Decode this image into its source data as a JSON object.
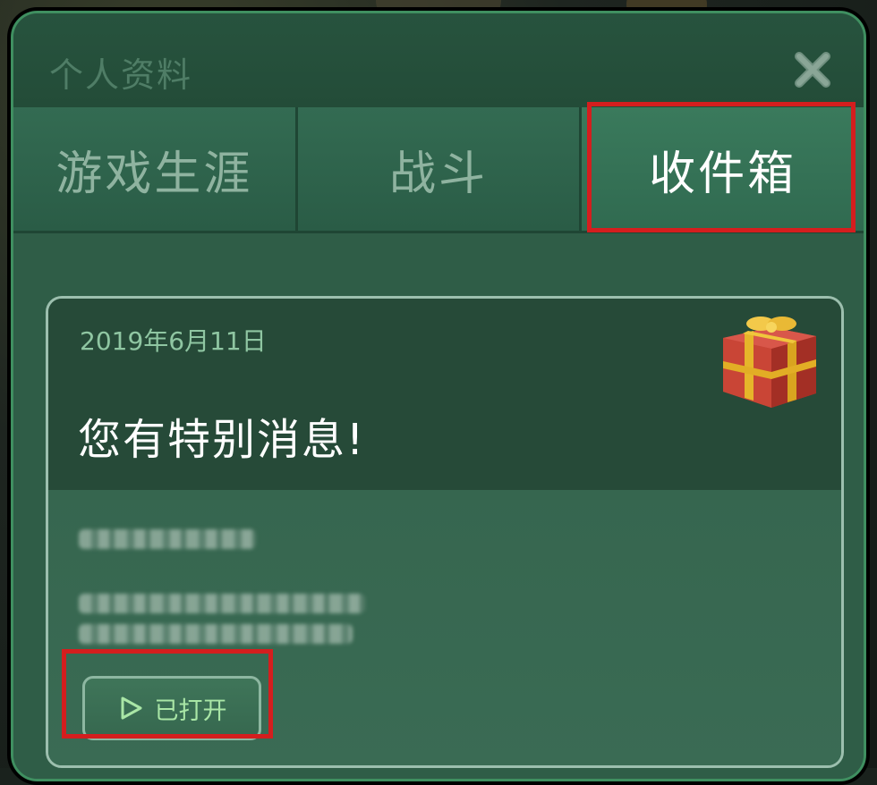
{
  "dialog": {
    "title": "个人资料",
    "close_icon": "close-x-icon"
  },
  "tabs": [
    {
      "label": "游戏生涯",
      "active": false
    },
    {
      "label": "战斗",
      "active": false
    },
    {
      "label": "收件箱",
      "active": true
    }
  ],
  "message": {
    "date": "2019年6月11日",
    "heading": "您有特别消息!",
    "icon": "gift-box-icon",
    "button_label": "已打开",
    "button_icon": "play-triangle-icon"
  },
  "colors": {
    "highlight": "#d41e1e",
    "panel": "#2d5a44",
    "accent_text": "#a9e6a6"
  }
}
